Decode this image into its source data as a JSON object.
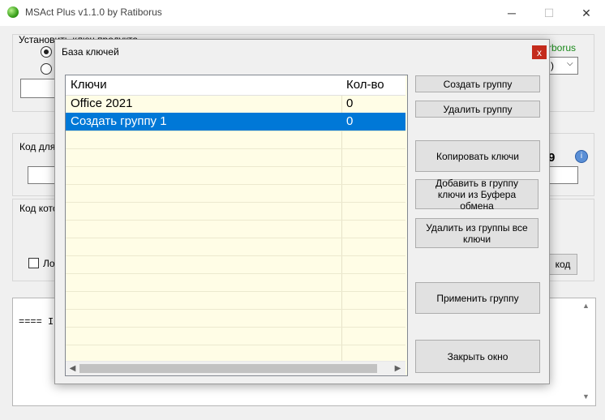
{
  "app": {
    "title": "MSAct Plus v1.1.0 by Ratiborus",
    "minimize_glyph": "─",
    "maximize_glyph": "☐",
    "close_glyph": "✕"
  },
  "background": {
    "group1_label": "Установить ключ продукта",
    "group2_label": "Код для",
    "group3_label": "Код кото",
    "green_label": "rborus",
    "combo_value": ")",
    "digit_label": "9",
    "checkbox_label": "Ло",
    "button_label": "код",
    "log_text": "==== I"
  },
  "dialog": {
    "title": "База ключей",
    "close_label": "x",
    "columns": [
      "Ключи",
      "Кол-во"
    ],
    "rows": [
      {
        "name": "Office 2021",
        "count": "0",
        "selected": false
      },
      {
        "name": "Создать группу 1",
        "count": "0",
        "selected": true
      }
    ],
    "buttons": {
      "create_group": "Создать группу",
      "delete_group": "Удалить группу",
      "copy_keys": "Копировать ключи",
      "add_from_clipboard": "Добавить в группу ключи из Буфера обмена",
      "delete_all_from_group": "Удалить из группы все ключи",
      "apply_group": "Применить группу",
      "close_window": "Закрыть окно"
    }
  },
  "colors": {
    "selection": "#0078d7",
    "grid_background": "#fffde6",
    "close_button": "#c42b1c"
  }
}
